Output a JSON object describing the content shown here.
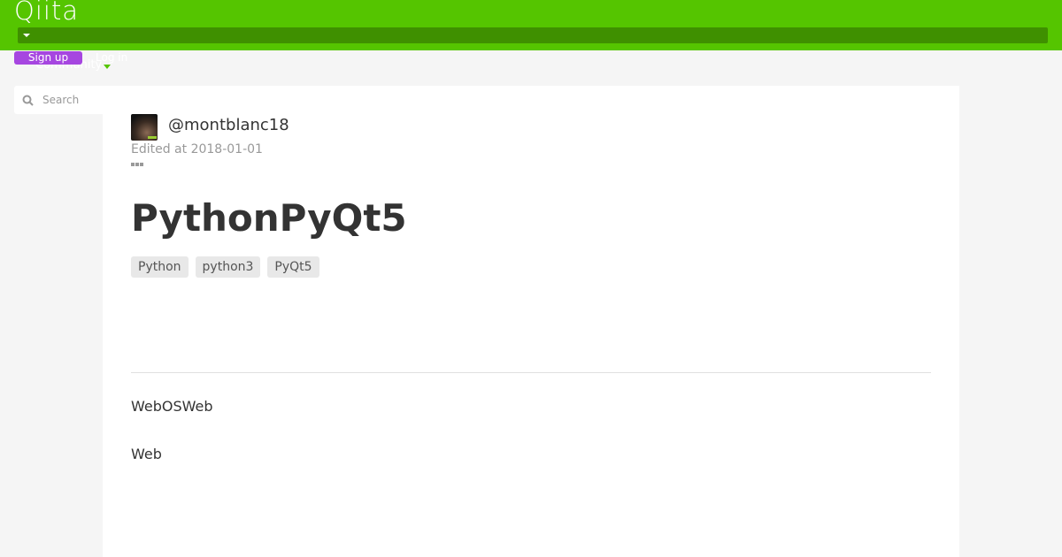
{
  "header": {
    "logo": "Qiita",
    "community_label": "Community",
    "signup_label": "Sign up",
    "login_label": "Log in",
    "brand_color": "#55c500",
    "signup_color": "#a646e0"
  },
  "search": {
    "placeholder": "Search",
    "icon": "search-icon"
  },
  "article": {
    "author": "@montblanc18",
    "edited": "Edited at 2018-01-01",
    "title": "PythonPyQt5",
    "tags": [
      "Python",
      "python3",
      "PyQt5"
    ],
    "paragraphs": [
      "WebOSWeb",
      "Web"
    ]
  }
}
